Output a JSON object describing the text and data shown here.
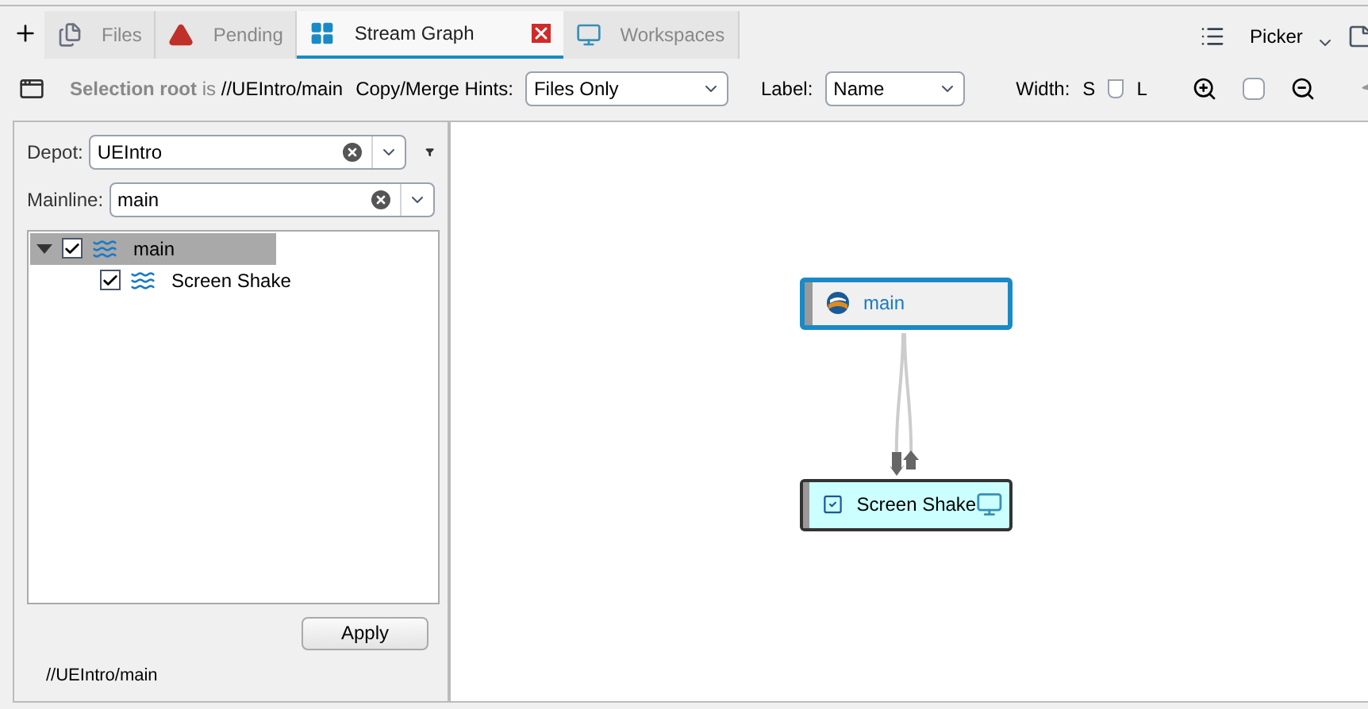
{
  "tabs": [
    {
      "label": "Files",
      "kind": "files",
      "selected": false
    },
    {
      "label": "Pending",
      "kind": "pending",
      "selected": false
    },
    {
      "label": "Stream Graph",
      "kind": "graph",
      "selected": true,
      "closable": true
    },
    {
      "label": "Workspaces",
      "kind": "workspaces",
      "selected": false
    }
  ],
  "picker": {
    "label": "Picker"
  },
  "toolbar": {
    "selection_label": "Selection root",
    "selection_is": "is",
    "selection_path": "//UEIntro/main",
    "hints_label": "Copy/Merge Hints:",
    "hints_value": "Files Only",
    "label_label": "Label:",
    "label_value": "Name",
    "width_label": "Width:",
    "width_small": "S",
    "width_large": "L",
    "zoom_checkbox_checked": false
  },
  "depot": {
    "label": "Depot:",
    "value": "UEIntro"
  },
  "mainline": {
    "label": "Mainline:",
    "value": "main"
  },
  "tree": [
    {
      "label": "main",
      "checked": true,
      "expanded": true,
      "selected": true,
      "children": [
        {
          "label": "Screen Shake",
          "checked": true,
          "selected": false
        }
      ]
    }
  ],
  "apply_button": "Apply",
  "status_path": "//UEIntro/main",
  "graph": {
    "nodes": [
      {
        "label": "main",
        "kind": "mainline",
        "selected": true
      },
      {
        "label": "Screen Shake",
        "kind": "task",
        "selected": false
      }
    ]
  }
}
